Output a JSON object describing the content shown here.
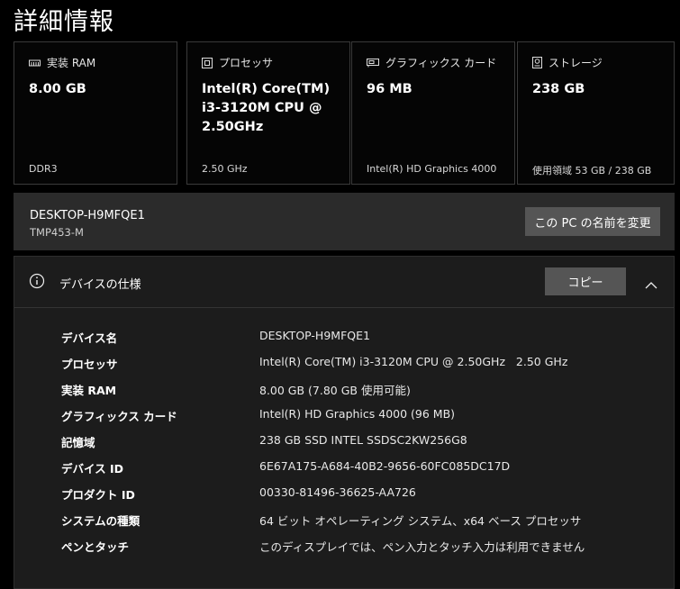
{
  "title": "詳細情報",
  "cards": [
    {
      "label": "実装 RAM",
      "value": "8.00 GB",
      "footer": "DDR3",
      "icon": "memory-icon"
    },
    {
      "label": "プロセッサ",
      "value": "Intel(R) Core(TM) i3-3120M CPU @ 2.50GHz",
      "footer": "2.50 GHz",
      "icon": "cpu-icon"
    },
    {
      "label": "グラフィックス カード",
      "value": "96 MB",
      "footer": "Intel(R) HD Graphics 4000",
      "icon": "graphics-card-icon"
    },
    {
      "label": "ストレージ",
      "value": "238 GB",
      "footer": "使用領域 53 GB / 238 GB",
      "icon": "storage-icon"
    }
  ],
  "device": {
    "name": "DESKTOP-H9MFQE1",
    "model": "TMP453-M",
    "rename_label": "この PC の名前を変更"
  },
  "specs": {
    "title": "デバイスの仕様",
    "copy_label": "コピー",
    "rows": [
      {
        "key": "デバイス名",
        "value": "DESKTOP-H9MFQE1"
      },
      {
        "key": "プロセッサ",
        "value": "Intel(R) Core(TM) i3-3120M CPU @ 2.50GHz   2.50 GHz"
      },
      {
        "key": "実装 RAM",
        "value": "8.00 GB (7.80 GB 使用可能)"
      },
      {
        "key": "グラフィックス カード",
        "value": "Intel(R) HD Graphics 4000 (96 MB)"
      },
      {
        "key": "記憶域",
        "value": "238 GB SSD INTEL SSDSC2KW256G8"
      },
      {
        "key": "デバイス ID",
        "value": "6E67A175-A684-40B2-9656-60FC085DC17D"
      },
      {
        "key": "プロダクト ID",
        "value": "00330-81496-36625-AA726"
      },
      {
        "key": "システムの種類",
        "value": "64 ビット オペレーティング システム、x64 ベース プロセッサ"
      },
      {
        "key": "ペンとタッチ",
        "value": "このディスプレイでは、ペン入力とタッチ入力は利用できません"
      }
    ]
  }
}
